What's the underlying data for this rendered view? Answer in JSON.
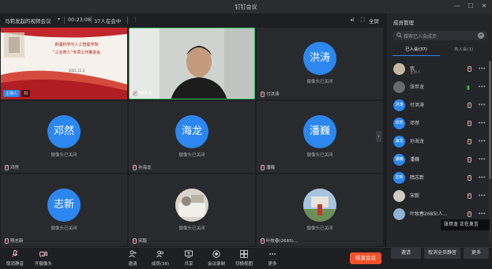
{
  "window": {
    "title": "钉钉会议",
    "minimize": "—",
    "maximize": "☐",
    "close": "✕"
  },
  "infobar": {
    "meeting_name": "马莉发起的视频会议",
    "duration": "00:23:08",
    "count": "37人在会中",
    "fullscreen": "全屏"
  },
  "tiles": [
    {
      "name": "主持人",
      "type": "share",
      "sub": "刘"
    },
    {
      "name": "张世龙",
      "type": "video"
    },
    {
      "name": "付洪涛",
      "avatar": "洪涛",
      "camera": "摄像头已关闭"
    },
    {
      "name": "邓然",
      "avatar": "邓然",
      "camera": "摄像头已关闭"
    },
    {
      "name": "孙海龙",
      "avatar": "海龙",
      "camera": "摄像头已关闭"
    },
    {
      "name": "潘巍",
      "avatar": "潘巍",
      "camera": "摄像头已关闭"
    },
    {
      "name": "隋志新",
      "avatar": "志新",
      "camera": "摄像头已关闭"
    },
    {
      "name": "宋毅",
      "avatar": "photo",
      "camera": "摄像头已关闭"
    },
    {
      "name": "叶牧春(2685)...",
      "avatar": "photo",
      "camera": "摄像头已关闭"
    }
  ],
  "slide": {
    "line1": "新疆科学与人工智能学院",
    "line2": "“三全育人”专项工作推进会",
    "date": "2021.11.3"
  },
  "toolbar": {
    "mute": "取消静音",
    "camera": "开摄像头",
    "invite": "邀请",
    "members": "成员(38)",
    "share": "共享",
    "record": "会议录制",
    "layout": "切换视图",
    "more": "更多",
    "end": "结束会议"
  },
  "panel": {
    "title": "成员管理",
    "search_placeholder": "搜索已入会成员",
    "tab_joined": "已入会(37)",
    "tab_not_joined": "未入会(1)",
    "members": [
      {
        "name": "我",
        "sub": "主持人",
        "avatar": ""
      },
      {
        "name": "张世龙",
        "avatar": ""
      },
      {
        "name": "付洪涛",
        "avatar": "洪涛"
      },
      {
        "name": "邓然",
        "avatar": "邓然"
      },
      {
        "name": "孙海龙",
        "avatar": "海龙"
      },
      {
        "name": "潘巍",
        "avatar": "潘巍"
      },
      {
        "name": "隋志新",
        "avatar": "志新"
      },
      {
        "name": "宋毅",
        "avatar": ""
      },
      {
        "name": "叶牧春2685(人...",
        "avatar": ""
      }
    ],
    "btn_invite": "邀请",
    "btn_mute_all": "取消全员静音",
    "btn_more": "更多",
    "speaking": "张世龙 正在发言"
  },
  "colors": {
    "accent": "#2c87f0",
    "end": "#f0522b",
    "speaking_border": "#2fbf5f"
  }
}
